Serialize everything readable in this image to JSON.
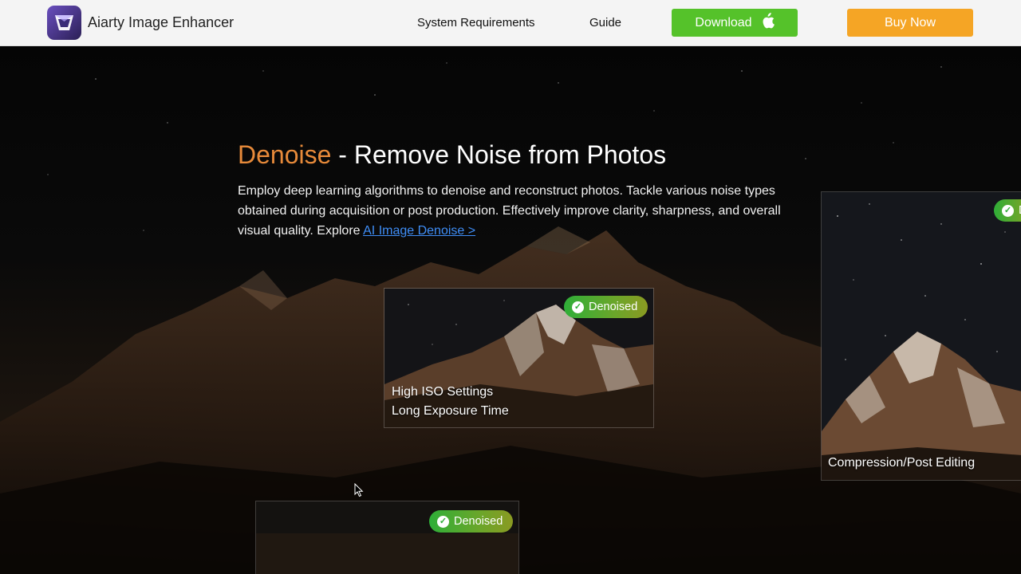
{
  "header": {
    "brand": "Aiarty Image Enhancer",
    "nav": [
      {
        "label": "System Requirements"
      },
      {
        "label": "Guide"
      }
    ],
    "download_label": "Download",
    "buy_label": "Buy Now"
  },
  "hero": {
    "title_accent": "Denoise",
    "title_rest": " - Remove Noise from Photos",
    "description": "Employ deep learning algorithms to denoise and reconstruct photos. Tackle various noise types obtained during acquisition or post production. Effectively improve clarity, sharpness, and overall visual quality. Explore ",
    "link_label": "AI Image Denoise >"
  },
  "cards": [
    {
      "badge": "Denoised",
      "caption_line1": "High ISO Settings",
      "caption_line2": "Long Exposure Time"
    },
    {
      "badge": "D",
      "caption_line1": "Compression/Post Editing"
    },
    {
      "badge": "Denoised"
    }
  ],
  "colors": {
    "accent": "#e78a3a",
    "download": "#55c22a",
    "buy": "#f5a525",
    "link": "#3f8ef7",
    "badge": "#2fae38"
  },
  "icons": [
    "app-logo-icon",
    "apple-icon",
    "check-circle-icon",
    "mouse-cursor-icon"
  ]
}
